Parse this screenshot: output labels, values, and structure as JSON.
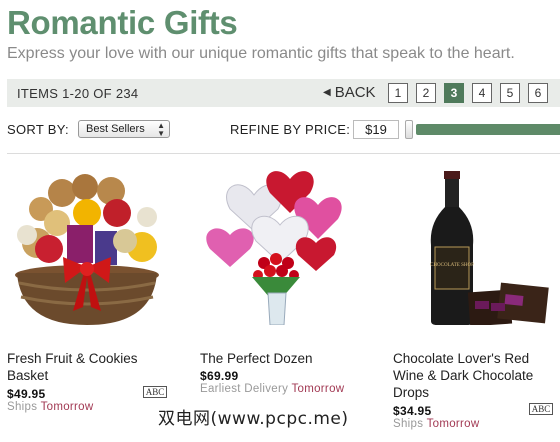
{
  "header": {
    "title": "Romantic Gifts",
    "subtitle": "Express your love with our unique romantic gifts that speak to the heart."
  },
  "paging": {
    "items_label": "ITEMS 1-20 OF 234",
    "back_label": "BACK",
    "back_arrow": "◀",
    "pages": [
      "1",
      "2",
      "3",
      "4",
      "5",
      "6"
    ],
    "active_page": "3"
  },
  "controls": {
    "sort_label": "SORT BY:",
    "sort_value": "Best Sellers",
    "sort_arrows": "▲▼",
    "refine_label": "REFINE BY PRICE:",
    "price_value": "$19"
  },
  "products": [
    {
      "name": "Fresh Fruit & Cookies Basket",
      "price": "$49.95",
      "ship_prefix": "Ships",
      "ship_when": "Tomorrow",
      "abc_label": "ABC",
      "image_icon": "fruit-basket-image"
    },
    {
      "name": "The Perfect Dozen",
      "price": "$69.99",
      "ship_prefix": "Earliest Delivery",
      "ship_when": "Tomorrow",
      "image_icon": "roses-balloons-image"
    },
    {
      "name": "Chocolate Lover's Red Wine & Dark Chocolate Drops",
      "price": "$34.95",
      "ship_prefix": "Ships",
      "ship_when": "Tomorrow",
      "abc_label": "ABC",
      "image_icon": "wine-chocolate-image",
      "wine_label": "CHOCOLATE SHOP"
    }
  ],
  "watermark": "双电网(www.pcpc.me)",
  "colors": {
    "title_green": "#5f8f6f",
    "active_page": "#4f7a5b",
    "slider": "#5e8a68",
    "ship_when": "#a23a54"
  }
}
